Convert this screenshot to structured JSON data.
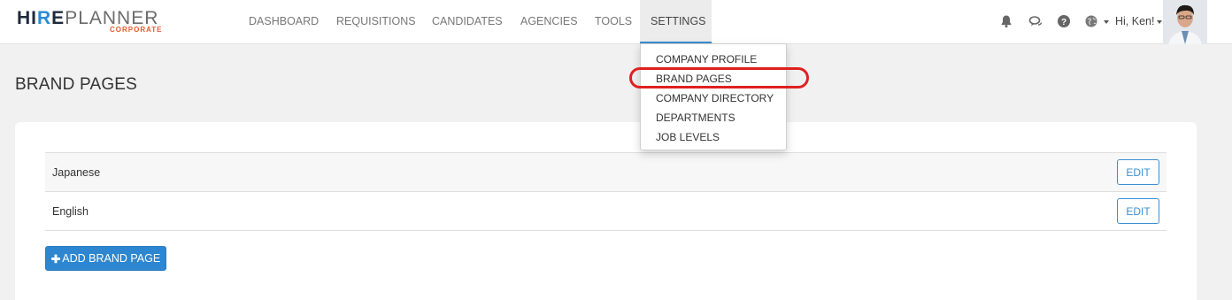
{
  "logo": {
    "bold_prefix": "HI",
    "dot_letter": "R",
    "bold_suffix": "E",
    "light": "PLANNER",
    "sub": "CORPORATE"
  },
  "nav": {
    "items": [
      "DASHBOARD",
      "REQUISITIONS",
      "CANDIDATES",
      "AGENCIES",
      "TOOLS",
      "SETTINGS"
    ],
    "active": "SETTINGS"
  },
  "header": {
    "icons": [
      "bell-icon",
      "chat-icon",
      "help-icon",
      "globe-icon"
    ],
    "greeting": "Hi, Ken!"
  },
  "settings_menu": {
    "items": [
      "COMPANY PROFILE",
      "BRAND PAGES",
      "COMPANY DIRECTORY",
      "DEPARTMENTS",
      "JOB LEVELS"
    ],
    "highlighted": "BRAND PAGES"
  },
  "page": {
    "title": "BRAND PAGES",
    "rows": [
      {
        "name": "Japanese",
        "action": "EDIT"
      },
      {
        "name": "English",
        "action": "EDIT"
      }
    ],
    "add_button": "ADD BRAND PAGE"
  },
  "colors": {
    "accent": "#3a8fd1",
    "primary_button": "#2d86cf",
    "logo_orange": "#e55a2b",
    "highlight_ring": "#e02020"
  }
}
